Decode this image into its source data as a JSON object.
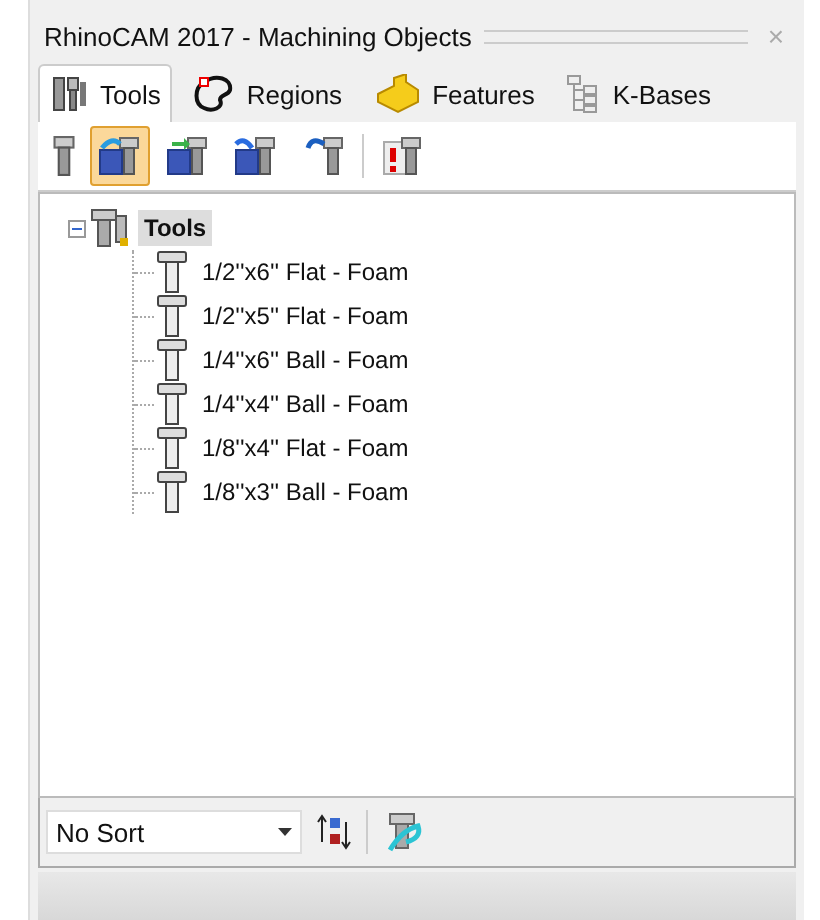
{
  "window": {
    "title": "RhinoCAM 2017 - Machining Objects",
    "close": "×"
  },
  "tabs": [
    {
      "label": "Tools",
      "selected": true,
      "kind": "tools"
    },
    {
      "label": "Regions",
      "selected": false,
      "kind": "regions"
    },
    {
      "label": "Features",
      "selected": false,
      "kind": "features"
    },
    {
      "label": "K-Bases",
      "selected": false,
      "kind": "kbases"
    }
  ],
  "toolbar": [
    {
      "kind": "mill",
      "selected": false
    },
    {
      "kind": "load",
      "selected": true
    },
    {
      "kind": "save",
      "selected": false
    },
    {
      "kind": "saveas",
      "selected": false
    },
    {
      "kind": "undo",
      "selected": false
    },
    {
      "kind": "sep"
    },
    {
      "kind": "delete",
      "selected": false
    }
  ],
  "tree": {
    "label": "Tools",
    "expanded": true,
    "selected": true,
    "children": [
      {
        "label": "1/2''x6'' Flat - Foam"
      },
      {
        "label": "1/2''x5'' Flat - Foam"
      },
      {
        "label": "1/4''x6'' Ball - Foam"
      },
      {
        "label": "1/4''x4'' Ball - Foam"
      },
      {
        "label": "1/8''x4'' Flat - Foam"
      },
      {
        "label": "1/8''x3'' Ball - Foam"
      }
    ]
  },
  "sort": {
    "value": "No Sort"
  }
}
